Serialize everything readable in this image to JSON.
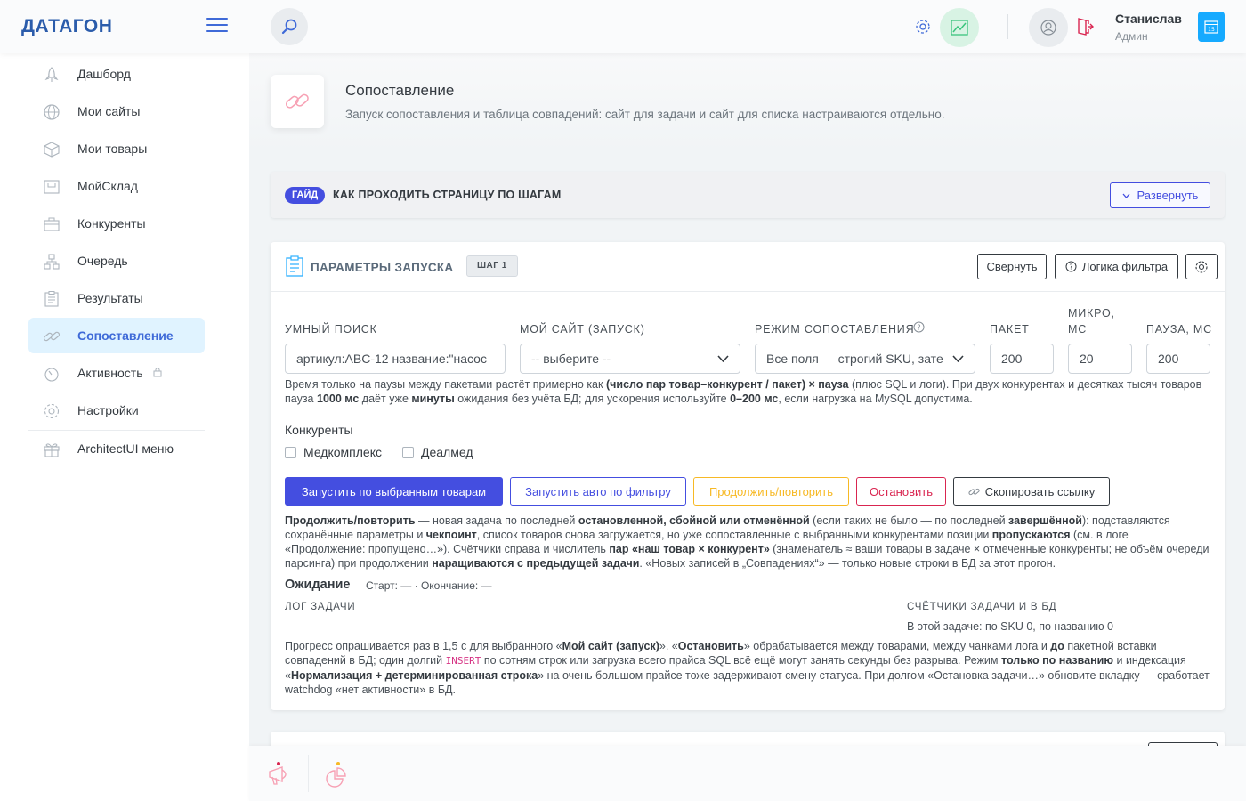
{
  "app": {
    "logo": "ДАТАГОН"
  },
  "header": {
    "user_name": "Станислав",
    "user_role": "Админ",
    "calendar_day": "15"
  },
  "sidebar": {
    "items": [
      {
        "label": "Дашборд",
        "icon": "rocket-icon"
      },
      {
        "label": "Мои сайты",
        "icon": "globe-icon"
      },
      {
        "label": "Мои товары",
        "icon": "box-icon"
      },
      {
        "label": "МойСклад",
        "icon": "warehouse-icon"
      },
      {
        "label": "Конкуренты",
        "icon": "briefcase-icon"
      },
      {
        "label": "Очередь",
        "icon": "network-icon"
      },
      {
        "label": "Результаты",
        "icon": "clipboard-icon"
      },
      {
        "label": "Сопоставление",
        "icon": "link-icon",
        "active": true
      },
      {
        "label": "Активность",
        "icon": "timer-icon"
      },
      {
        "label": "Настройки",
        "icon": "gear-icon"
      },
      {
        "label": "ArchitectUI меню",
        "icon": "gift-icon"
      }
    ]
  },
  "page": {
    "title": "Сопоставление",
    "subtitle": "Запуск сопоставления и таблица совпадений: сайт для задачи и сайт для списка настраиваются отдельно."
  },
  "guide": {
    "badge": "ГАЙД",
    "title": "КАК ПРОХОДИТЬ СТРАНИЦУ ПО ШАГАМ",
    "expand_label": "Развернуть"
  },
  "params": {
    "title": "ПАРАМЕТРЫ ЗАПУСКА",
    "step": "ШАГ 1",
    "collapse_label": "Свернуть",
    "filter_logic_label": "Логика фильтра",
    "smart_search_label": "УМНЫЙ ПОИСК",
    "smart_search_value": "артикул:ABC-12 название:\"насос",
    "my_site_label": "МОЙ САЙТ (ЗАПУСК)",
    "my_site_value": "-- выберите --",
    "mode_label": "РЕЖИМ СОПОСТАВЛЕНИЯ",
    "mode_value": "Все поля — строгий SKU, зате",
    "batch_label": "ПАКЕТ",
    "batch_value": "200",
    "micro_label_1": "МИКРО,",
    "micro_label_2": "МС",
    "micro_value": "20",
    "pause_label": "ПАУЗА, МС",
    "pause_value": "200",
    "hint": {
      "t1": "Время только на паузы между пакетами растёт примерно как ",
      "b1": "(число пар товар–конкурент / пакет) × пауза",
      "t2": " (плюс SQL и логи). При двух конкурентах и десятках тысяч товаров пауза ",
      "b2": "1000 мс",
      "t3": " даёт уже ",
      "b3": "минуты",
      "t4": " ожидания без учёта БД; для ускорения используйте ",
      "b4": "0–200 мс",
      "t5": ", если нагрузка на MySQL допустима."
    },
    "competitors_label": "Конкуренты",
    "competitors": [
      "Медкомплекс",
      "Деалмед"
    ]
  },
  "actions": {
    "run_selected": "Запустить по выбранным товарам",
    "run_auto": "Запустить авто по фильтру",
    "continue": "Продолжить/повторить",
    "stop": "Остановить",
    "copy_link": "Скопировать ссылку"
  },
  "continue_note": {
    "b1": "Продолжить/повторить",
    "t1": " — новая задача по последней ",
    "b2": "остановленной, сбойной или отменённой",
    "t2": " (если таких не было — по последней ",
    "b3": "завершённой",
    "t3": "): подставляются сохранённые параметры и ",
    "b4": "чекпоинт",
    "t4": ", список товаров снова загружается, но уже сопоставленные с выбранными конкурентами позиции ",
    "b5": "пропускаются",
    "t5": " (см. в логе «Продолжение: пропущено…»). Счётчики справа и числитель ",
    "b6": "пар «наш товар × конкурент»",
    "t6": " (знаменатель ≈ ваши товары в задаче × отмеченные конкуренты; не объём очереди парсинга) при продолжении ",
    "b7": "наращиваются с предыдущей задачи",
    "t7": ". «Новых записей в „Совпадениях“» — только новые строки в БД за этот прогон."
  },
  "status": {
    "title": "Ожидание",
    "times": "Старт: — · Окончание: —",
    "log_label": "ЛОГ ЗАДАЧИ",
    "counters_label": "СЧЁТЧИКИ ЗАДАЧИ И В БД",
    "counters_value": "В этой задаче: по SKU 0, по названию 0"
  },
  "progress_note": {
    "t1": "Прогресс опрашивается раз в 1,5 с для выбранного «",
    "b1": "Мой сайт (запуск)",
    "t2": "». «",
    "b2": "Остановить",
    "t3": "» обрабатывается между товарами, между чанками лога и ",
    "b3": "до",
    "t4": " пакетной вставки совпадений в БД; один долгий ",
    "code": "INSERT",
    "t5": " по сотням строк или загрузка всего прайса SQL всё ещё могут занять секунды без разрыва. Режим ",
    "b4": "только по названию",
    "t6": " и индексация «",
    "b5": "Нормализация + детерминированная строка",
    "t7": "» на очень большом прайсе тоже задерживают смену статуса. При долгом «Остановка задачи…» обновите вкладку — сработает watchdog «нет активности» в БД."
  },
  "colors": {
    "primary": "#444ee0",
    "accent_blue": "#3f6ad8",
    "warning": "#f7b924",
    "danger": "#d92550"
  }
}
